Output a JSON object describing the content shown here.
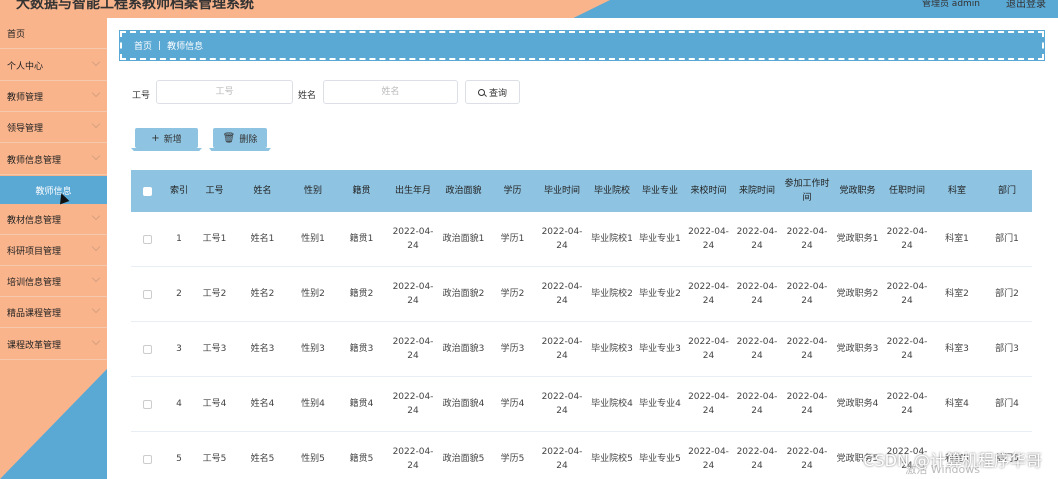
{
  "header": {
    "title": "大数据与智能工程系教师档案管理系统",
    "user": "管理员 admin",
    "logout": "退出登录"
  },
  "sidebar": {
    "items": [
      {
        "label": "首页",
        "has_chevron": false
      },
      {
        "label": "个人中心",
        "has_chevron": true
      },
      {
        "label": "教师管理",
        "has_chevron": true
      },
      {
        "label": "领导管理",
        "has_chevron": true
      },
      {
        "label": "教师信息管理",
        "has_chevron": true
      },
      {
        "label": "教材信息管理",
        "has_chevron": true
      },
      {
        "label": "科研项目管理",
        "has_chevron": true
      },
      {
        "label": "培训信息管理",
        "has_chevron": true
      },
      {
        "label": "精品课程管理",
        "has_chevron": true
      },
      {
        "label": "课程改革管理",
        "has_chevron": true
      }
    ],
    "active_sub": "教师信息"
  },
  "breadcrumb": {
    "home": "首页",
    "current": "教师信息"
  },
  "search": {
    "field1_label": "工号",
    "field1_placeholder": "工号",
    "field2_label": "姓名",
    "field2_placeholder": "姓名",
    "button": "查询"
  },
  "actions": {
    "add": "新增",
    "delete": "删除"
  },
  "table": {
    "columns": [
      "索引",
      "工号",
      "姓名",
      "性别",
      "籍贯",
      "出生年月",
      "政治面貌",
      "学历",
      "毕业时间",
      "毕业院校",
      "毕业专业",
      "来校时间",
      "来院时间",
      "参加工作时间",
      "党政职务",
      "任职时间",
      "科室",
      "部门"
    ],
    "rows": [
      [
        "1",
        "工号1",
        "姓名1",
        "性别1",
        "籍贯1",
        "2022-04-24",
        "政治面貌1",
        "学历1",
        "2022-04-24",
        "毕业院校1",
        "毕业专业1",
        "2022-04-24",
        "2022-04-24",
        "2022-04-24",
        "党政职务1",
        "2022-04-24",
        "科室1",
        "部门1"
      ],
      [
        "2",
        "工号2",
        "姓名2",
        "性别2",
        "籍贯2",
        "2022-04-24",
        "政治面貌2",
        "学历2",
        "2022-04-24",
        "毕业院校2",
        "毕业专业2",
        "2022-04-24",
        "2022-04-24",
        "2022-04-24",
        "党政职务2",
        "2022-04-24",
        "科室2",
        "部门2"
      ],
      [
        "3",
        "工号3",
        "姓名3",
        "性别3",
        "籍贯3",
        "2022-04-24",
        "政治面貌3",
        "学历3",
        "2022-04-24",
        "毕业院校3",
        "毕业专业3",
        "2022-04-24",
        "2022-04-24",
        "2022-04-24",
        "党政职务3",
        "2022-04-24",
        "科室3",
        "部门3"
      ],
      [
        "4",
        "工号4",
        "姓名4",
        "性别4",
        "籍贯4",
        "2022-04-24",
        "政治面貌4",
        "学历4",
        "2022-04-24",
        "毕业院校4",
        "毕业专业4",
        "2022-04-24",
        "2022-04-24",
        "2022-04-24",
        "党政职务4",
        "2022-04-24",
        "科室4",
        "部门4"
      ],
      [
        "5",
        "工号5",
        "姓名5",
        "性别5",
        "籍贯5",
        "2022-04-24",
        "政治面貌5",
        "学历5",
        "2022-04-24",
        "毕业院校5",
        "毕业专业5",
        "2022-04-24",
        "2022-04-24",
        "2022-04-24",
        "党政职务5",
        "2022-04-24",
        "科室5",
        "部门5"
      ]
    ]
  },
  "watermark": "CSDN @计算机程序华哥",
  "os_watermark": "激活 Windows",
  "colors": {
    "primary_blue": "#5aa8d4",
    "table_header": "#8ec3e1",
    "sidebar_orange": "#f9b48c"
  }
}
